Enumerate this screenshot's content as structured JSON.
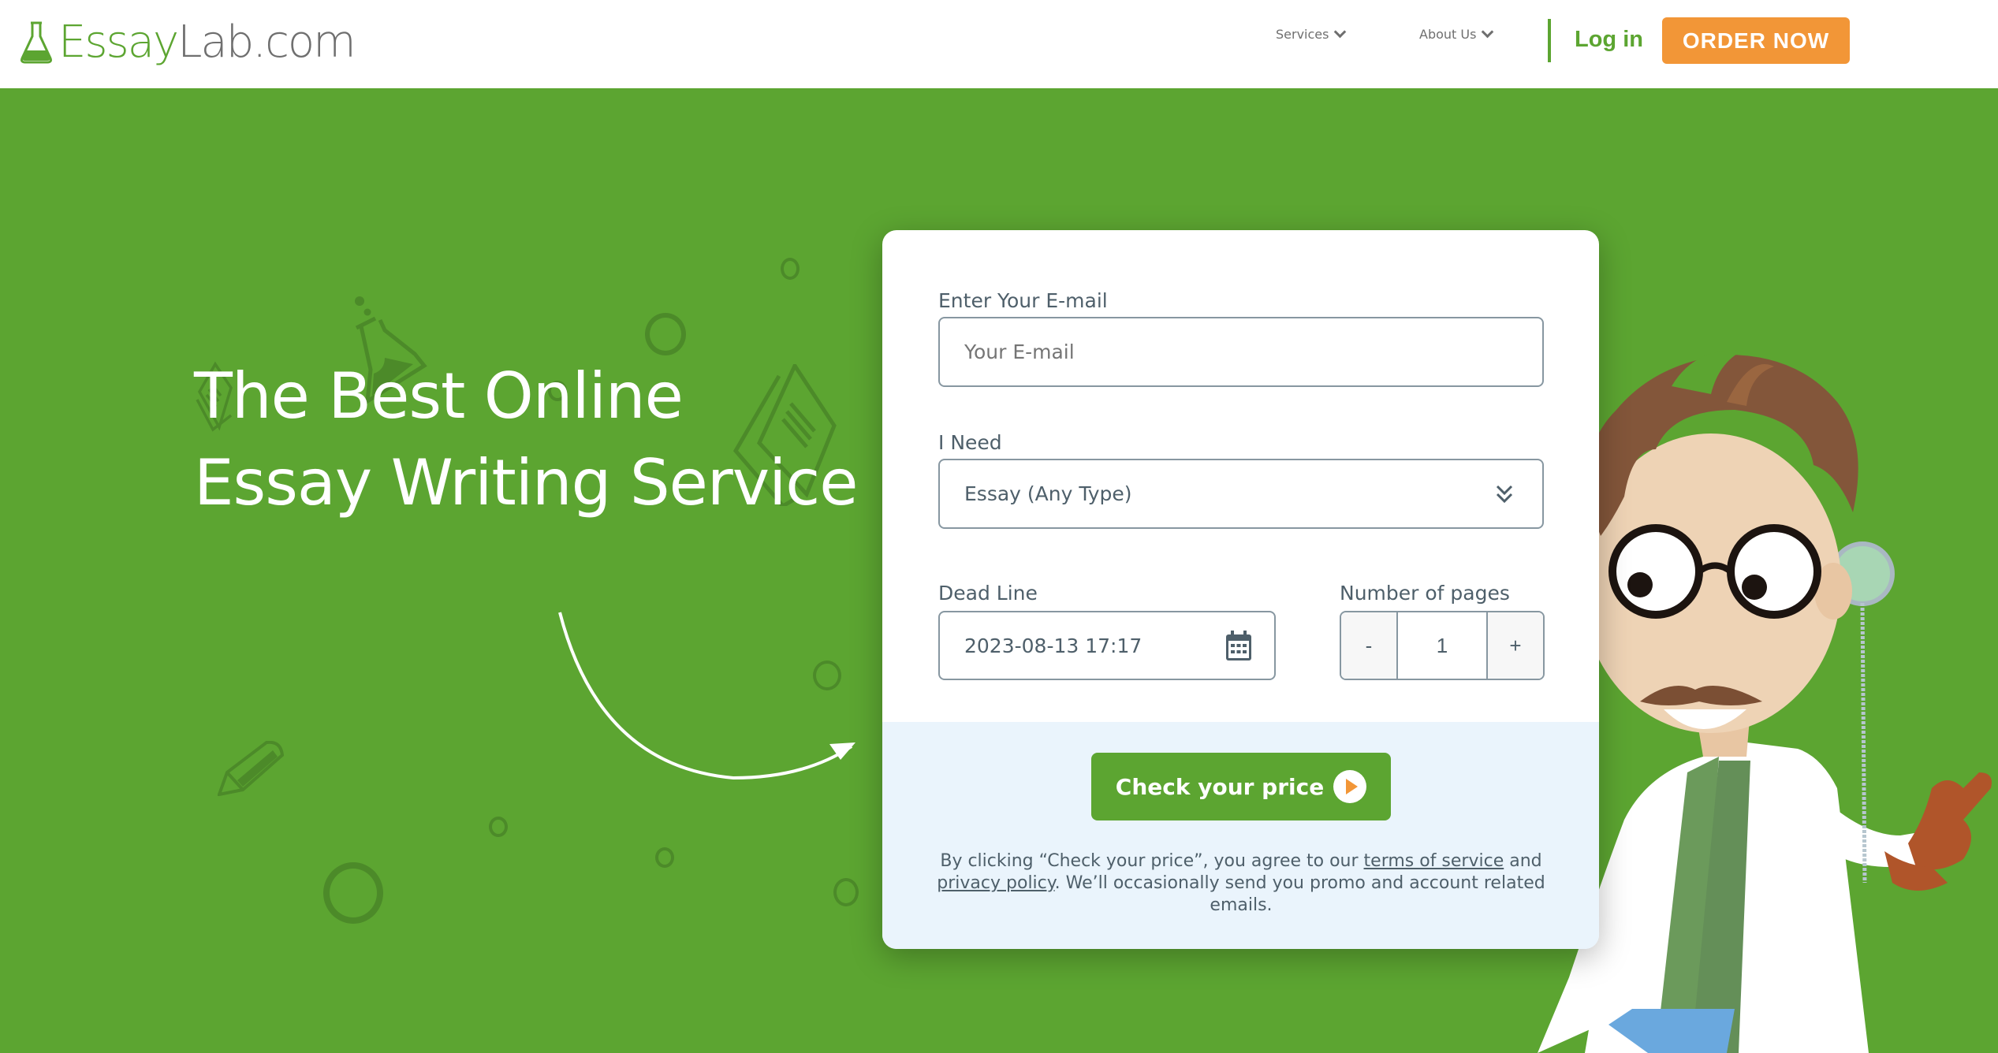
{
  "header": {
    "logo": {
      "part1": "Essay",
      "part2": "Lab.com",
      "icon": "flask-icon"
    },
    "nav": [
      {
        "label": "Services",
        "icon": "chevron-down-icon"
      },
      {
        "label": "About Us",
        "icon": "chevron-down-icon"
      }
    ],
    "login_label": "Log in",
    "order_label": "ORDER NOW"
  },
  "hero": {
    "headline_line1": "The Best Online",
    "headline_line2": "Essay Writing Service"
  },
  "form": {
    "email": {
      "label": "Enter Your E-mail",
      "placeholder": "Your E-mail",
      "value": ""
    },
    "need": {
      "label": "I Need",
      "value": "Essay (Any Type)",
      "icon": "double-chevron-down-icon"
    },
    "deadline": {
      "label": "Dead Line",
      "value": "2023-08-13 17:17",
      "icon": "calendar-icon"
    },
    "pages": {
      "label": "Number of pages",
      "value": "1",
      "minus": "-",
      "plus": "+"
    },
    "submit_label": "Check your price",
    "disclaimer": {
      "part1": "By clicking “Check your price”, you agree to our ",
      "terms_link": "terms of service",
      "part2": " and ",
      "privacy_link": "privacy policy",
      "part3": ". We’ll occasionally send you promo and account related emails."
    }
  },
  "colors": {
    "brand_green": "#5ca531",
    "accent_orange": "#f29637",
    "text_gray": "#4e5f6a",
    "footer_bg": "#eaf4fc"
  }
}
